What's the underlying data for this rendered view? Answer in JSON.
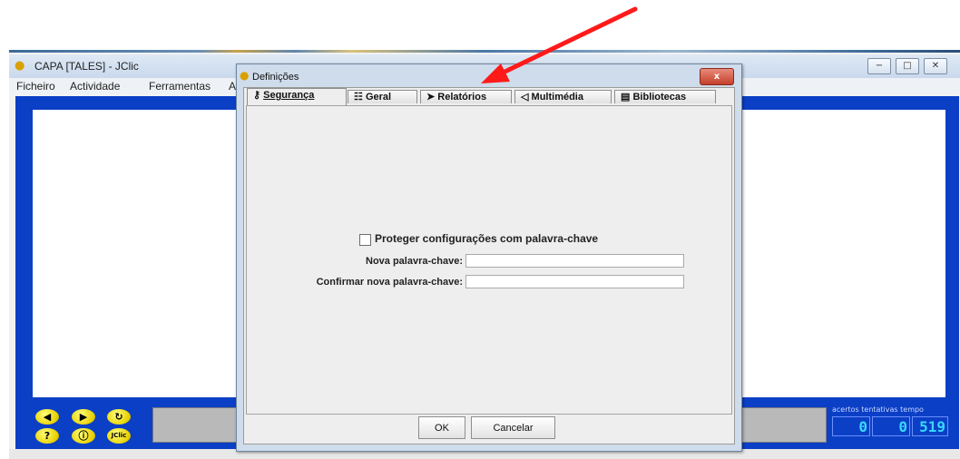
{
  "window": {
    "title": "CAPA [TALES] - JClic",
    "controls": {
      "minimize": "−",
      "maximize": "□",
      "close": "✕"
    }
  },
  "menu": {
    "items": [
      "Ficheiro",
      "Actividade",
      "Ferramentas",
      "A"
    ]
  },
  "toolbar": {
    "buttons": [
      {
        "icon": "prev-icon",
        "glyph": "◀"
      },
      {
        "icon": "next-icon",
        "glyph": "▶"
      },
      {
        "icon": "reload-icon",
        "glyph": "↻"
      },
      {
        "icon": "help-icon",
        "glyph": "?"
      },
      {
        "icon": "info-icon",
        "glyph": "ⓘ"
      },
      {
        "icon": "jclic-logo",
        "glyph": "JClic"
      }
    ]
  },
  "counters": {
    "labels": "acertos  tentativas  tempo",
    "acertos": "0",
    "tentativas": "0",
    "tempo": "519"
  },
  "dialog": {
    "title": "Definições",
    "close_label": "x",
    "tabs": [
      {
        "label": "Segurança",
        "icon": "key-icon",
        "glyph": "⚷",
        "active": true
      },
      {
        "label": "Geral",
        "icon": "settings-icon",
        "glyph": "☷",
        "active": false
      },
      {
        "label": "Relatórios",
        "icon": "report-icon",
        "glyph": "➤",
        "active": false
      },
      {
        "label": "Multimédia",
        "icon": "speaker-icon",
        "glyph": "◁",
        "active": false
      },
      {
        "label": "Bibliotecas",
        "icon": "library-icon",
        "glyph": "▤",
        "active": false
      }
    ],
    "security": {
      "protect_label": "Proteger configurações com palavra-chave",
      "protect_checked": false,
      "new_password_label": "Nova palavra-chave:",
      "new_password_value": "",
      "confirm_password_label": "Confirmar nova palavra-chave:",
      "confirm_password_value": ""
    },
    "ok_label": "OK",
    "cancel_label": "Cancelar"
  },
  "colors": {
    "workarea": "#0b3fc6",
    "annotation_arrow": "#ff1a1a"
  }
}
